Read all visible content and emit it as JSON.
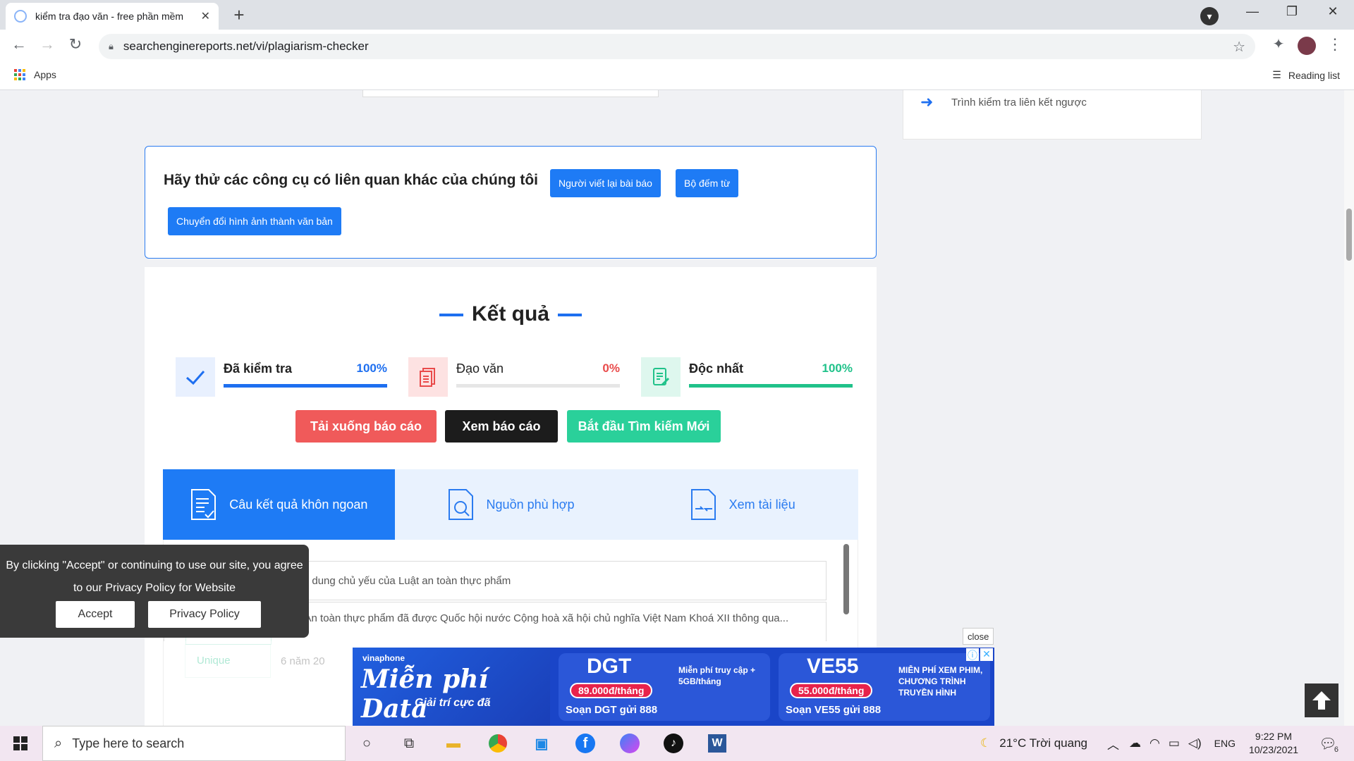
{
  "browser": {
    "tab_title": "kiểm tra đạo văn - free phần mềm",
    "url": "searchenginereports.net/vi/plagiarism-checker",
    "apps_label": "Apps",
    "reading_list": "Reading list"
  },
  "sidebar": {
    "item": "Trình kiểm tra liên kết ngược"
  },
  "tools": {
    "heading": "Hãy thử các công cụ có liên quan khác của chúng tôi",
    "btn1": "Người viết lại bài báo",
    "btn2": "Bộ đếm từ",
    "btn3": "Chuyển đổi hình ảnh thành văn bản"
  },
  "results": {
    "title": "Kết quả",
    "stats": [
      {
        "name": "Đã kiểm tra",
        "percent": "100%",
        "value": 100,
        "color": "#1e6ff0"
      },
      {
        "name": "Đạo văn",
        "percent": "0%",
        "value": 0,
        "color": "#e94b4b"
      },
      {
        "name": "Độc nhất",
        "percent": "100%",
        "value": 100,
        "color": "#20c28a"
      }
    ],
    "download": "Tải xuống báo cáo",
    "view": "Xem báo cáo",
    "new_search": "Bắt đầu Tìm kiếm Mới",
    "tabs": [
      "Câu kết quả khôn ngoan",
      "Nguồn phù hợp",
      "Xem tài liệu"
    ],
    "rows": [
      {
        "text": "1. Nội dung chủ yếu của Luật an toàn thực phẩm",
        "badge": ""
      },
      {
        "text": "Luật An toàn thực phẩm đã được Quốc hội nước Cộng hoà xã hội chủ nghĩa Việt Nam Khoá XII thông qua...",
        "badge": "Unique"
      },
      {
        "text": "6 năm 20",
        "badge": "Unique"
      }
    ]
  },
  "cookie": {
    "text": "By clicking \"Accept\" or continuing to use our site, you agree to our Privacy Policy for Website",
    "accept": "Accept",
    "policy": "Privacy Policy"
  },
  "ad": {
    "close": "close",
    "brand": "vinaphone",
    "headline": "Miễn phí Data",
    "sub": "Giải trí cực đã",
    "pkg1": {
      "code": "DGT",
      "price": "89.000đ/tháng",
      "sms": "Soạn DGT gửi 888",
      "note": "Miễn phí truy cập + 5GB/tháng"
    },
    "pkg2": {
      "code": "VE55",
      "price": "55.000đ/tháng",
      "sms": "Soạn VE55 gửi 888",
      "note": "MIỄN PHÍ XEM PHIM, CHƯƠNG TRÌNH TRUYỀN HÌNH"
    }
  },
  "taskbar": {
    "search": "Type here to search",
    "weather": "21°C  Trời quang",
    "lang": "ENG",
    "time": "9:22 PM",
    "date": "10/23/2021",
    "notif": "6"
  }
}
